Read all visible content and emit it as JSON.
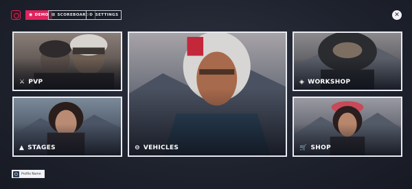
{
  "nav": {
    "tabs": [
      {
        "label": "DEMO",
        "icon": "◉",
        "active": true
      },
      {
        "label": "SCOREBOARDS",
        "icon": "⊞",
        "active": false
      },
      {
        "label": "SETTINGS",
        "icon": "⚙",
        "active": false
      }
    ],
    "close_icon": "✕"
  },
  "tiles": {
    "pvp": {
      "label": "PVP",
      "icon": "⚔"
    },
    "stages": {
      "label": "STAGES",
      "icon": "▲"
    },
    "vehicles": {
      "label": "VEHICLES",
      "icon": "⊖"
    },
    "workshop": {
      "label": "WORKSHOP",
      "icon": "◈"
    },
    "shop": {
      "label": "SHOP",
      "icon": "🛒"
    }
  },
  "profile": {
    "name": "Profile Name"
  },
  "colors": {
    "accent": "#e0245e",
    "border": "#e9ecf2",
    "background": "#1e222d"
  }
}
